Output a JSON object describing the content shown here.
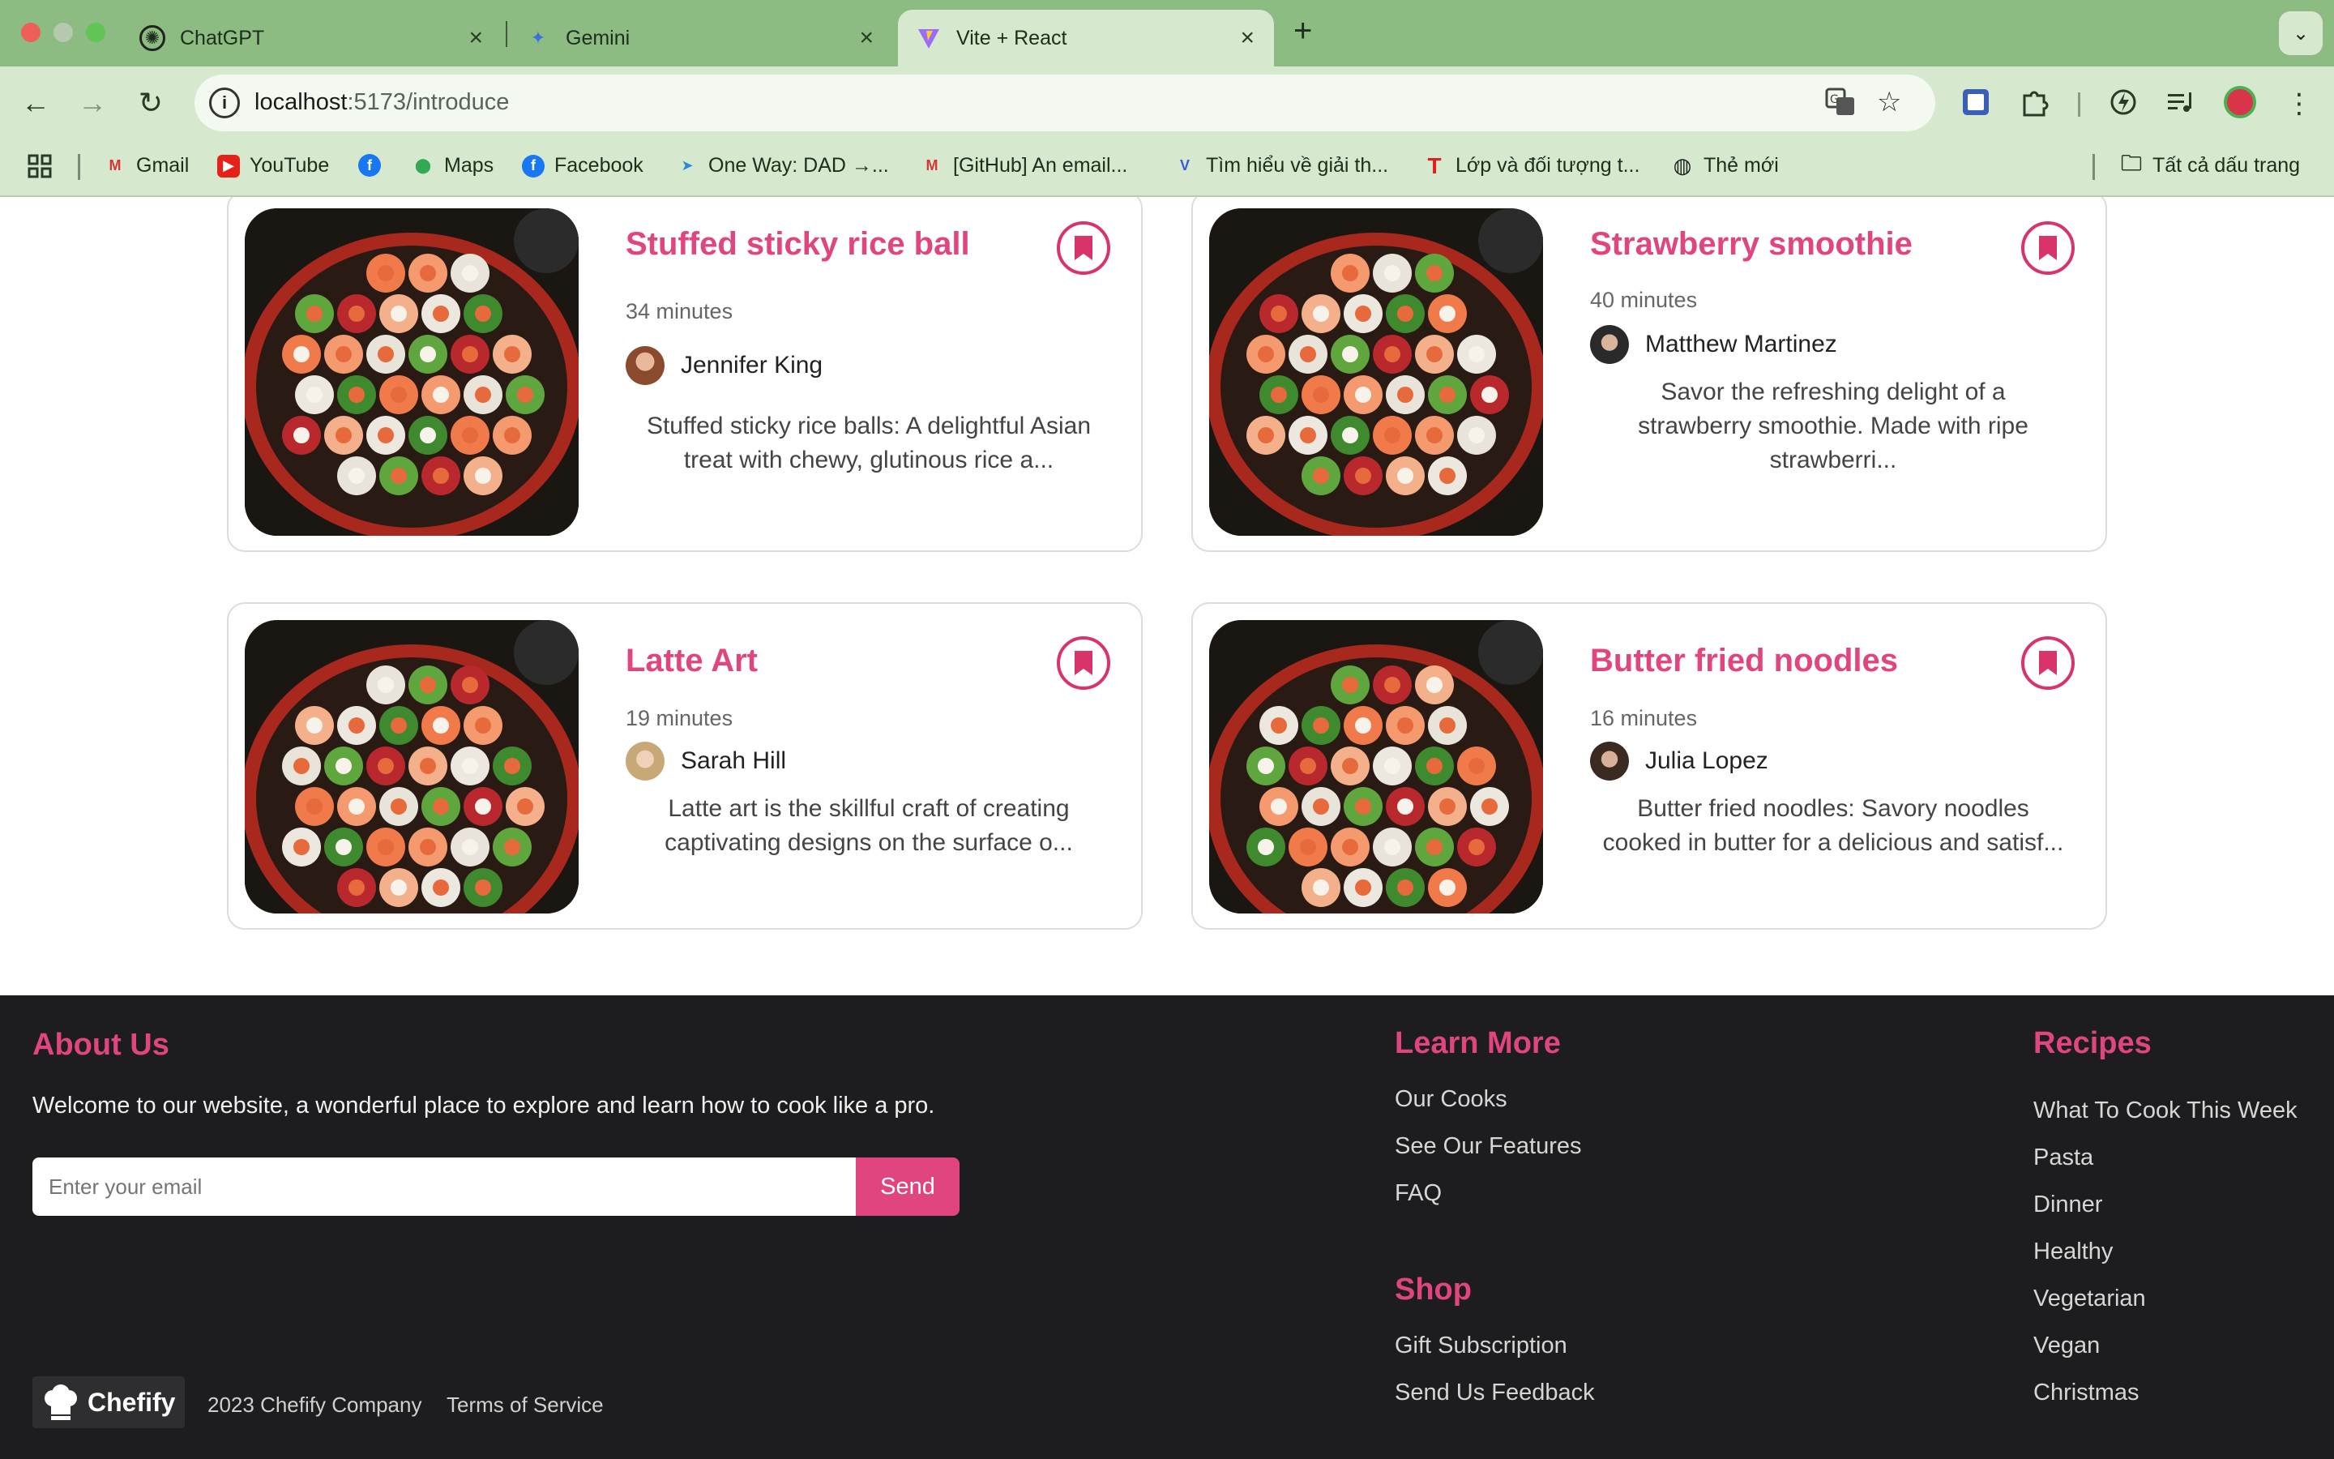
{
  "browser": {
    "tabs": [
      {
        "label": "ChatGPT"
      },
      {
        "label": "Gemini"
      },
      {
        "label": "Vite + React"
      }
    ],
    "url_host": "localhost",
    "url_path": ":5173/introduce",
    "bookmarks": [
      {
        "label": "Gmail"
      },
      {
        "label": "YouTube"
      },
      {
        "label": ""
      },
      {
        "label": "Maps"
      },
      {
        "label": "Facebook"
      },
      {
        "label": "One Way: DAD →..."
      },
      {
        "label": "[GitHub] An email..."
      },
      {
        "label": "Tìm hiểu về giải th..."
      },
      {
        "label": "Lớp và đối tượng t..."
      },
      {
        "label": "Thẻ mới"
      }
    ],
    "all_bookmarks": "Tất cả dấu trang"
  },
  "recipes": [
    {
      "title": "Stuffed sticky rice ball",
      "time": "34 minutes",
      "author": "Jennifer King",
      "description_lines": [
        "Stuffed sticky rice balls: A delightful Asian",
        "treat with chewy, glutinous rice a..."
      ]
    },
    {
      "title": "Strawberry smoothie",
      "time": "40 minutes",
      "author": "Matthew Martinez",
      "description_lines": [
        "Savor the refreshing delight of a",
        "strawberry smoothie. Made with ripe",
        "strawberri..."
      ]
    },
    {
      "title": "Latte Art",
      "time": "19 minutes",
      "author": "Sarah Hill",
      "description_lines": [
        "Latte art is the skillful craft of creating",
        "captivating designs on the surface o..."
      ]
    },
    {
      "title": "Butter fried noodles",
      "time": "16 minutes",
      "author": "Julia Lopez",
      "description_lines": [
        "Butter fried noodles: Savory noodles",
        "cooked in butter for a delicious and satisf..."
      ]
    }
  ],
  "footer": {
    "about_title": "About Us",
    "about_text": "Welcome to our website, a wonderful place to explore and learn how to cook like a pro.",
    "email_placeholder": "Enter your email",
    "send_label": "Send",
    "learn_more_title": "Learn More",
    "learn_more_links": [
      "Our Cooks",
      "See Our Features",
      "FAQ"
    ],
    "shop_title": "Shop",
    "shop_links": [
      "Gift Subscription",
      "Send Us Feedback"
    ],
    "recipes_title": "Recipes",
    "recipes_links": [
      "What To Cook This Week",
      "Pasta",
      "Dinner",
      "Healthy",
      "Vegetarian",
      "Vegan",
      "Christmas"
    ],
    "brand": "Chefify",
    "copyright": "2023 Chefify Company",
    "terms": "Terms of Service"
  },
  "colors": {
    "accent": "#e0457f",
    "footer_bg": "#1d1d1f",
    "chrome_bg": "#8cbc82"
  }
}
